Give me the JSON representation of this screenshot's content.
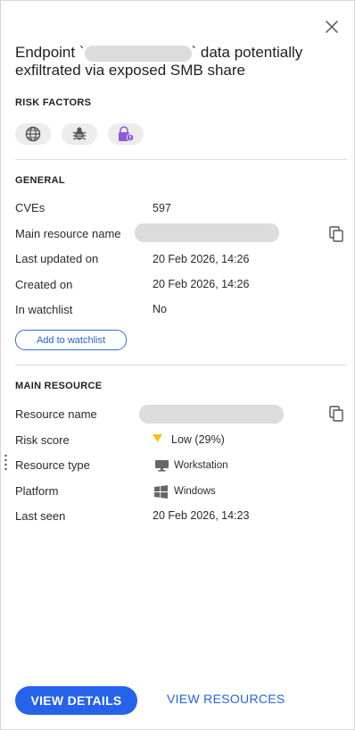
{
  "header": {
    "title_start": "Endpoint `",
    "title_end": "` data potentially exfiltrated via exposed SMB share",
    "close_icon": "close-icon"
  },
  "risk_factors": {
    "label": "RISK FACTORS",
    "icons": [
      "globe-icon",
      "bug-icon",
      "lock-alert-icon"
    ],
    "colors": {
      "pill_bg": "#ececec",
      "neutral": "#555555",
      "accent": "#8b5bd6"
    }
  },
  "general": {
    "label": "GENERAL",
    "cves_label": "CVEs",
    "cves_value": "597",
    "main_resource_label": "Main resource name",
    "last_updated_label": "Last updated on",
    "last_updated_value": "20 Feb 2026, 14:26",
    "created_label": "Created on",
    "created_value": "20 Feb 2026, 14:26",
    "watchlist_label": "In watchlist",
    "watchlist_value": "No",
    "add_watchlist": "Add to watchlist"
  },
  "main_resource": {
    "label": "MAIN RESOURCE",
    "resource_name_label": "Resource name",
    "risk_score_label": "Risk score",
    "risk_score_value": "Low (29%)",
    "risk_color": "#f0c419",
    "resource_type_label": "Resource type",
    "resource_type_value": "Workstation",
    "platform_label": "Platform",
    "platform_value": "Windows",
    "last_seen_label": "Last seen",
    "last_seen_value": "20 Feb 2026, 14:23"
  },
  "footer": {
    "view_details": "VIEW DETAILS",
    "view_resources": "VIEW RESOURCES",
    "primary_color": "#2563eb"
  }
}
